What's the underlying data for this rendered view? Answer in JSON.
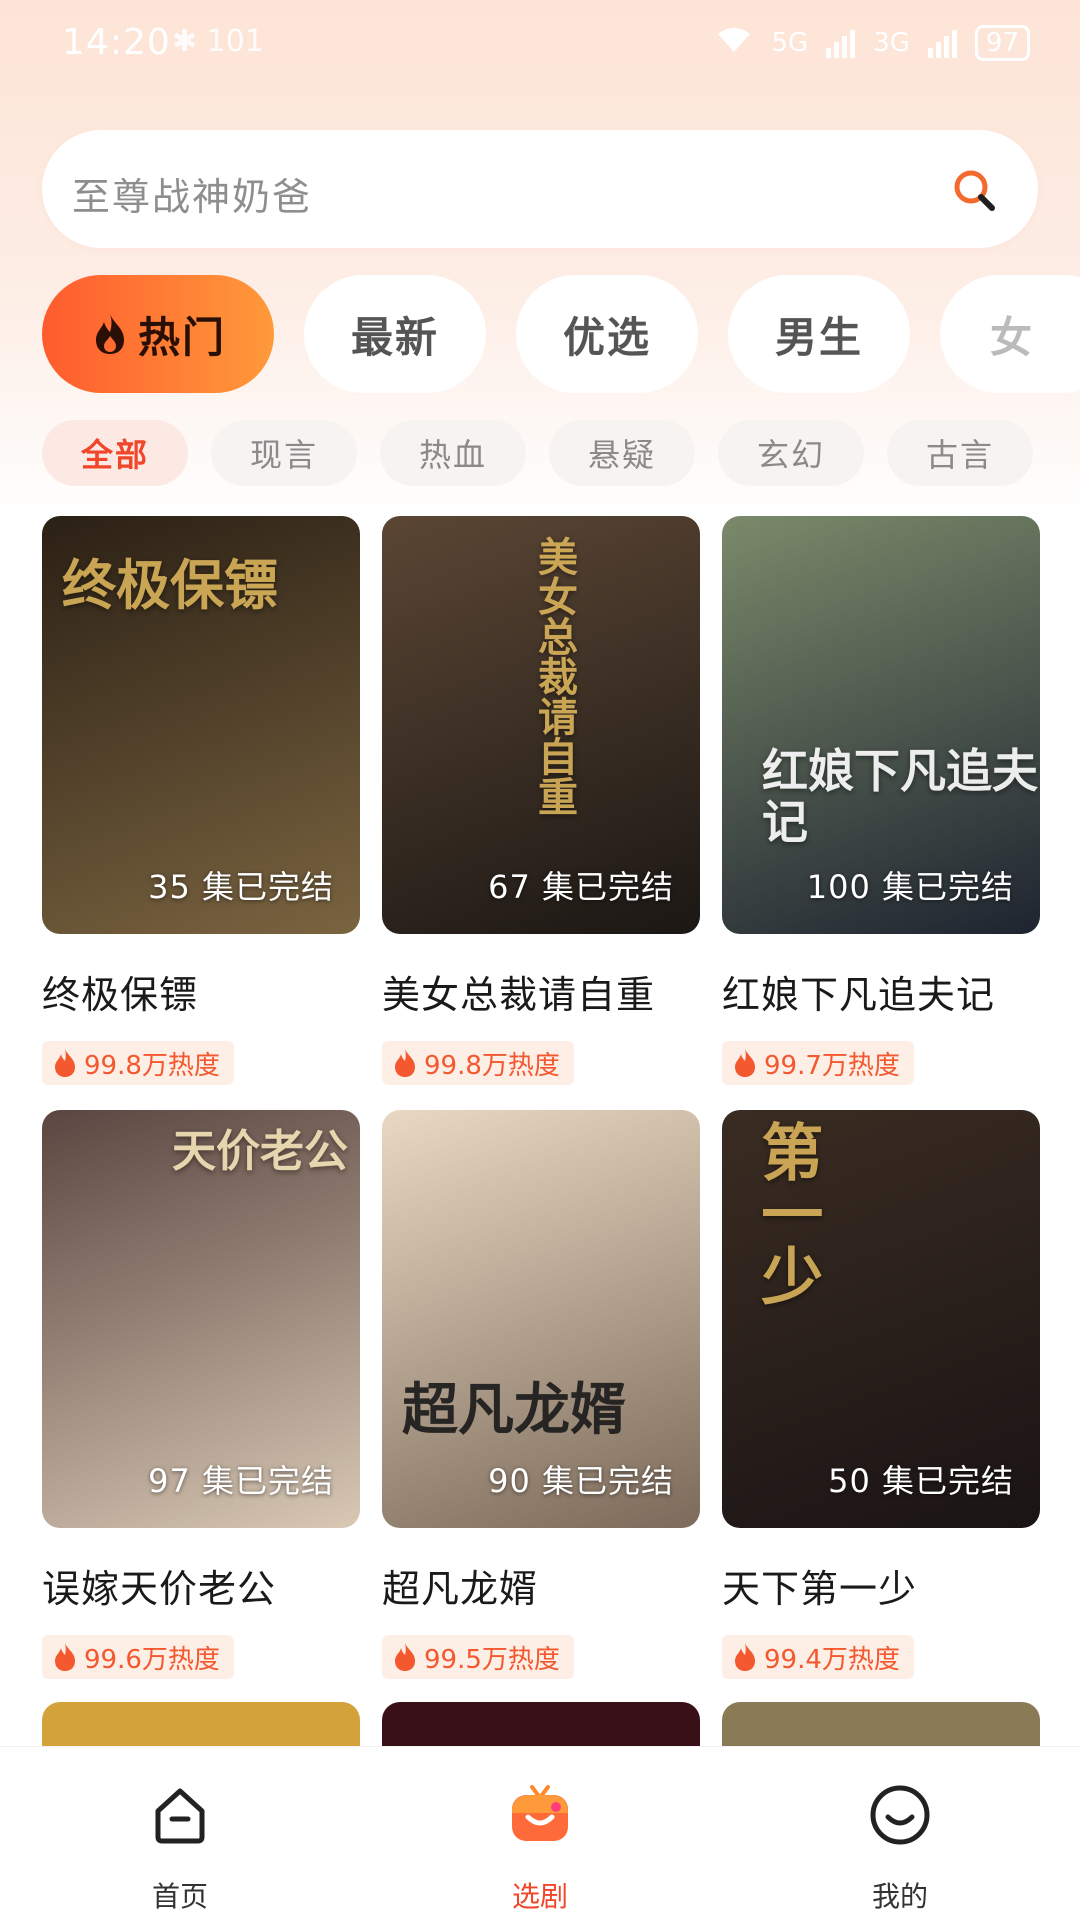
{
  "status_bar": {
    "time": "14:20",
    "left_icons": "✱ 101",
    "network_5g": "5G",
    "network_3g": "3G",
    "battery": "97"
  },
  "search": {
    "placeholder": "至尊战神奶爸",
    "icon": "search-icon"
  },
  "main_tabs": [
    {
      "label": "热门",
      "icon": "fire-icon",
      "active": true
    },
    {
      "label": "最新",
      "active": false
    },
    {
      "label": "优选",
      "active": false
    },
    {
      "label": "男生",
      "active": false
    },
    {
      "label": "女",
      "active": false
    }
  ],
  "sub_tabs": [
    {
      "label": "全部",
      "active": true
    },
    {
      "label": "现言",
      "active": false
    },
    {
      "label": "热血",
      "active": false
    },
    {
      "label": "悬疑",
      "active": false
    },
    {
      "label": "玄幻",
      "active": false
    },
    {
      "label": "古言",
      "active": false
    }
  ],
  "dramas": [
    {
      "title": "终极保镖",
      "episodes": "35 集已完结",
      "heat": "99.8万热度",
      "poster_text": "终极保镖",
      "colors": [
        "#2b2015",
        "#7a6440"
      ]
    },
    {
      "title": "美女总裁请自重",
      "episodes": "67 集已完结",
      "heat": "99.8万热度",
      "poster_text": "美女总裁请自重",
      "colors": [
        "#5b4634",
        "#1b1714"
      ]
    },
    {
      "title": "红娘下凡追夫记",
      "episodes": "100 集已完结",
      "heat": "99.7万热度",
      "poster_text": "红娘下凡追夫记",
      "colors": [
        "#7b8a6a",
        "#1e2430"
      ]
    },
    {
      "title": "误嫁天价老公",
      "episodes": "97 集已完结",
      "heat": "99.6万热度",
      "poster_text": "天价老公",
      "colors": [
        "#5a4540",
        "#d8c8b4"
      ]
    },
    {
      "title": "超凡龙婿",
      "episodes": "90 集已完结",
      "heat": "99.5万热度",
      "poster_text": "超凡龙婿",
      "colors": [
        "#e9d9c3",
        "#7c6a5a"
      ]
    },
    {
      "title": "天下第一少",
      "episodes": "50 集已完结",
      "heat": "99.4万热度",
      "poster_text": "第一少",
      "colors": [
        "#3a2c22",
        "#1a1414"
      ]
    }
  ],
  "partial_row_colors": [
    "#d4a23a",
    "#3a1018",
    "#8a7a55"
  ],
  "bottom_nav": [
    {
      "label": "首页",
      "icon": "home-icon",
      "active": false
    },
    {
      "label": "选剧",
      "icon": "tv-icon",
      "active": true
    },
    {
      "label": "我的",
      "icon": "smile-icon",
      "active": false
    }
  ],
  "colors": {
    "accent": "#f0462a",
    "accent_gradient_end": "#ff9a3a"
  }
}
